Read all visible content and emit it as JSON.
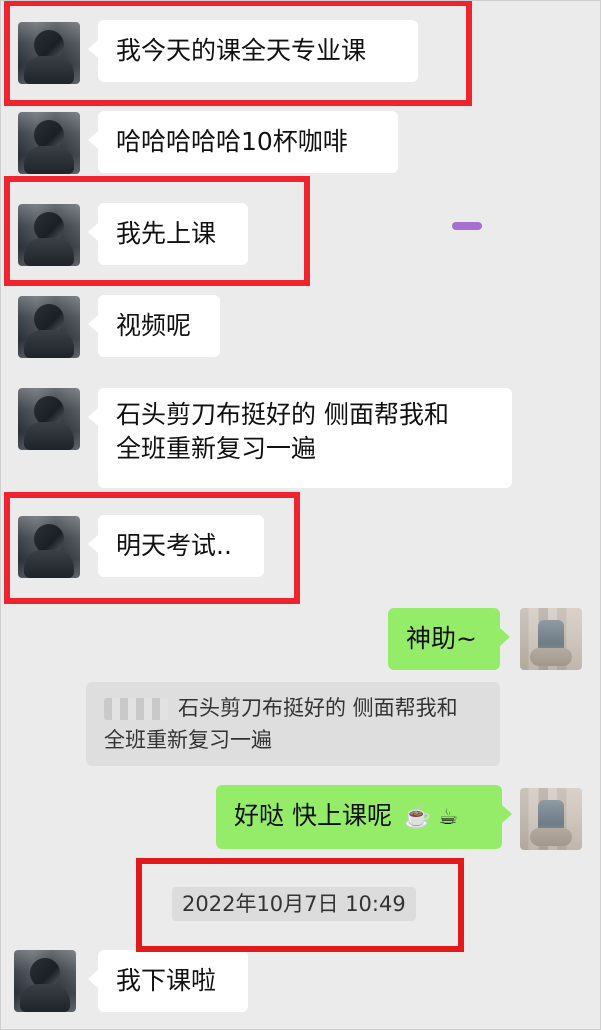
{
  "messages": [
    {
      "id": "m1",
      "side": "left",
      "text": "我今天的课全天专业课",
      "highlighted": true
    },
    {
      "id": "m2",
      "side": "left",
      "text": "哈哈哈哈哈10杯咖啡",
      "highlighted": false
    },
    {
      "id": "m3",
      "side": "left",
      "text": "我先上课",
      "highlighted": true
    },
    {
      "id": "m4",
      "side": "left",
      "text": "视频呢",
      "highlighted": false
    },
    {
      "id": "m5",
      "side": "left",
      "text_lines": [
        "石头剪刀布挺好的 侧面帮我和",
        "全班重新复习一遍"
      ],
      "highlighted": false
    },
    {
      "id": "m6",
      "side": "left",
      "text": "明天考试..",
      "highlighted": true
    },
    {
      "id": "m7",
      "side": "right",
      "text": "神助~"
    },
    {
      "id": "m8",
      "side": "quote",
      "text_lines": [
        "石头剪刀布挺好的 侧面帮我和",
        "全班重新复习一遍"
      ]
    },
    {
      "id": "m9",
      "side": "right",
      "text": "好哒 快上课呢",
      "emoji": "☕️ ☕"
    },
    {
      "id": "ts",
      "side": "timestamp",
      "text": "2022年10月7日 10:49",
      "highlighted": true
    },
    {
      "id": "m10",
      "side": "left",
      "text": "我下课啦"
    }
  ],
  "colors": {
    "background": "#ebebeb",
    "incoming_bubble": "#ffffff",
    "outgoing_bubble": "#95ec69",
    "highlight_box": "#f0242e",
    "quote_background": "#dedede",
    "timestamp_background": "#dcdcdc"
  },
  "icons": {
    "contact_avatar": "pixelated-avatar-icon",
    "self_avatar": "pixelated-self-avatar-icon",
    "coffee": "coffee-icon"
  }
}
